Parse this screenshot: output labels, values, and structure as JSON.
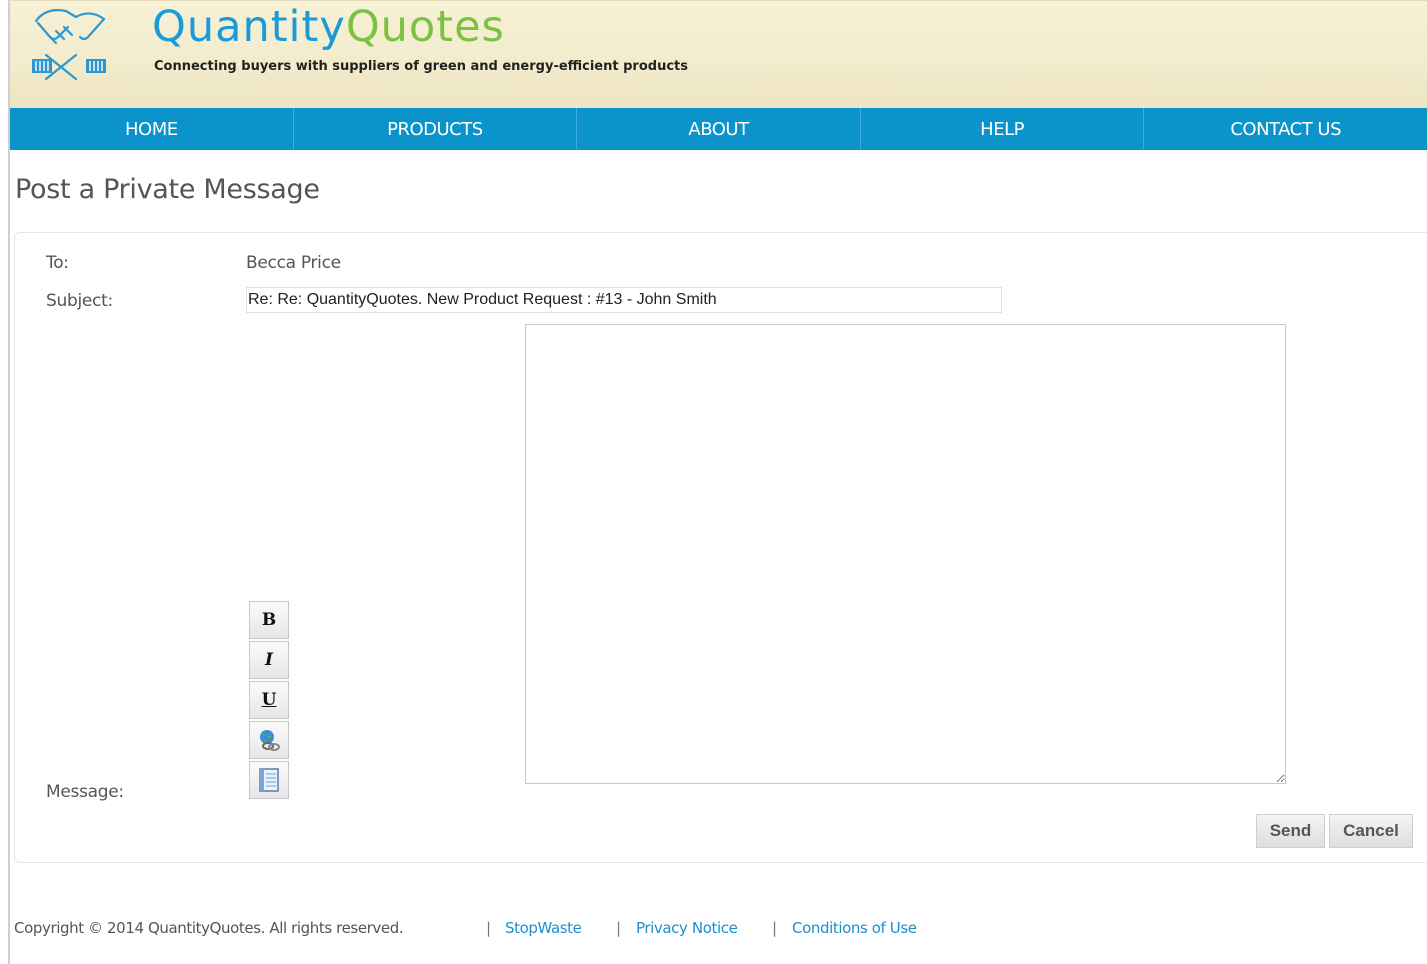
{
  "header": {
    "brand_part1": "Quantity",
    "brand_part2": "Quotes",
    "tagline": "Connecting buyers with suppliers of green and energy-efficient products"
  },
  "nav": {
    "items": [
      "HOME",
      "PRODUCTS",
      "ABOUT",
      "HELP",
      "CONTACT US"
    ]
  },
  "page": {
    "title": "Post a Private Message"
  },
  "form": {
    "to_label": "To:",
    "to_value": "Becca Price",
    "subject_label": "Subject:",
    "subject_value": "Re: Re: QuantityQuotes. New Product Request : #13 - John Smith",
    "message_label": "Message:",
    "message_value": "",
    "toolbar": {
      "bold": "B",
      "italic": "I",
      "underline": "U",
      "link_icon": "link-globe-icon",
      "quote_icon": "notebook-icon"
    },
    "send_label": "Send",
    "cancel_label": "Cancel"
  },
  "footer": {
    "copyright": "Copyright © 2014 QuantityQuotes. All rights reserved.",
    "separator": "|",
    "links": [
      "StopWaste",
      "Privacy Notice",
      "Conditions of Use"
    ]
  },
  "colors": {
    "nav_bg": "#0b93cc",
    "brand_blue": "#1a9ad6",
    "brand_green": "#7cc242",
    "link": "#1d8fcc",
    "header_bg": "#f2ebcc"
  }
}
